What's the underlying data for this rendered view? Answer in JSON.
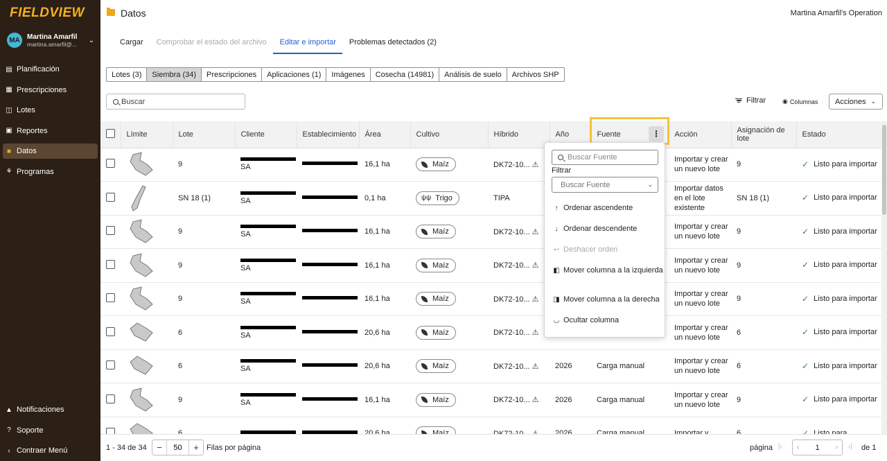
{
  "app": {
    "logo": "FIELDVIEW",
    "user_initials": "MA",
    "user_name": "Martina Amarfil",
    "user_email": "martina.amarfil@..."
  },
  "sidebar": {
    "items": [
      {
        "label": "Planificación",
        "icon": "planning-icon"
      },
      {
        "label": "Prescripciones",
        "icon": "grid-icon"
      },
      {
        "label": "Lotes",
        "icon": "map-icon"
      },
      {
        "label": "Reportes",
        "icon": "report-icon"
      },
      {
        "label": "Datos",
        "icon": "folder-icon"
      },
      {
        "label": "Programas",
        "icon": "sprout-icon"
      }
    ],
    "bottom": [
      {
        "label": "Notificaciones",
        "icon": "bell-icon"
      },
      {
        "label": "Soporte",
        "icon": "help-icon"
      },
      {
        "label": "Contraer Menú",
        "icon": "chevron-left-icon"
      }
    ]
  },
  "header": {
    "title": "Datos",
    "operation": "Martina Amarfil's Operation"
  },
  "steps": [
    "Cargar",
    "Comprobar el estado del archivo",
    "Editar e importar",
    "Problemas detectados (2)"
  ],
  "tabs": [
    "Lotes (3)",
    "Siembra (34)",
    "Prescripciones",
    "Aplicaciones (1)",
    "Imágenes",
    "Cosecha (14981)",
    "Análisis de suelo",
    "Archivos SHP"
  ],
  "toolbar": {
    "search_placeholder": "Buscar",
    "filter": "Filtrar",
    "columns": "Columnas",
    "actions": "Acciones"
  },
  "table": {
    "headers": [
      "Límite",
      "Lote",
      "Cliente",
      "Establecimiento",
      "Área",
      "Cultivo",
      "Híbrido",
      "Año",
      "Fuente",
      "Acción",
      "Asignación de lote",
      "Estado"
    ],
    "rows": [
      {
        "lote": "9",
        "cliente": "SA",
        "area": "16,1 ha",
        "cultivo": "Maíz",
        "hibrido": "DK72-10...",
        "anio": "",
        "fuente": "",
        "accion": "Importar y crear un nuevo lote",
        "asignacion": "9",
        "estado": "Listo para importar"
      },
      {
        "lote": "SN 18 (1)",
        "cliente": "SA",
        "area": "0,1 ha",
        "cultivo": "Trigo",
        "hibrido": "TIPA",
        "anio": "",
        "fuente": "",
        "accion": "Importar datos en el lote existente",
        "asignacion": "SN 18 (1)",
        "estado": "Listo para importar"
      },
      {
        "lote": "9",
        "cliente": "SA",
        "area": "16,1 ha",
        "cultivo": "Maíz",
        "hibrido": "DK72-10...",
        "anio": "",
        "fuente": "",
        "accion": "Importar y crear un nuevo lote",
        "asignacion": "9",
        "estado": "Listo para importar"
      },
      {
        "lote": "9",
        "cliente": "SA",
        "area": "16,1 ha",
        "cultivo": "Maíz",
        "hibrido": "DK72-10...",
        "anio": "",
        "fuente": "",
        "accion": "Importar y crear un nuevo lote",
        "asignacion": "9",
        "estado": "Listo para importar"
      },
      {
        "lote": "9",
        "cliente": "SA",
        "area": "16,1 ha",
        "cultivo": "Maíz",
        "hibrido": "DK72-10...",
        "anio": "",
        "fuente": "",
        "accion": "Importar y crear un nuevo lote",
        "asignacion": "9",
        "estado": "Listo para importar"
      },
      {
        "lote": "6",
        "cliente": "SA",
        "area": "20,6 ha",
        "cultivo": "Maíz",
        "hibrido": "DK72-10...",
        "anio": "",
        "fuente": "",
        "accion": "Importar y crear un nuevo lote",
        "asignacion": "6",
        "estado": "Listo para importar"
      },
      {
        "lote": "6",
        "cliente": "SA",
        "area": "20,6 ha",
        "cultivo": "Maíz",
        "hibrido": "DK72-10...",
        "anio": "2026",
        "fuente": "Carga manual",
        "accion": "Importar y crear un nuevo lote",
        "asignacion": "6",
        "estado": "Listo para importar"
      },
      {
        "lote": "9",
        "cliente": "SA",
        "area": "16,1 ha",
        "cultivo": "Maíz",
        "hibrido": "DK72-10...",
        "anio": "2026",
        "fuente": "Carga manual",
        "accion": "Importar y crear un nuevo lote",
        "asignacion": "9",
        "estado": "Listo para importar"
      },
      {
        "lote": "6",
        "cliente": "",
        "area": "20,6 ha",
        "cultivo": "Maíz",
        "hibrido": "DK72-10...",
        "anio": "2026",
        "fuente": "Carga manual",
        "accion": "Importar y",
        "asignacion": "6",
        "estado": "Listo para"
      }
    ]
  },
  "menu": {
    "search_placeholder": "Buscar Fuente",
    "filter_label": "Filtrar",
    "select_placeholder": "Buscar Fuente",
    "items": [
      "Ordenar ascendente",
      "Ordenar descendente",
      "Deshacer orden",
      "Mover columna a la izquierda",
      "Mover columna a la derecha",
      "Ocultar columna"
    ]
  },
  "footer": {
    "range": "1 - 34 de 34",
    "rows_per_page": "50",
    "rows_label": "Filas por página",
    "page_label": "página",
    "page_value": "1",
    "of_label": "de 1"
  },
  "colors": {
    "sidebar": "#2b1f16",
    "accent": "#1f5fd6",
    "highlight": "#f3c23a",
    "logo": "#f5b21a"
  }
}
